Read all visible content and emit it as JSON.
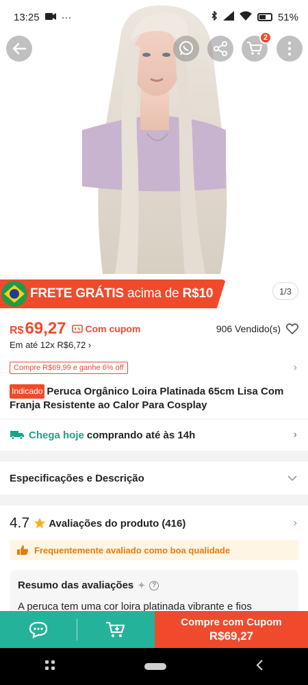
{
  "status": {
    "time": "13:25",
    "battery": "51%"
  },
  "hero": {
    "pager": "1/3",
    "cart_count": "2"
  },
  "banner": {
    "text_bold": "FRETE GRÁTIS",
    "text_light": "acima de",
    "text_amount": "R$10"
  },
  "price": {
    "currency": "R$",
    "value": "69,27",
    "coupon_label": "Com cupom",
    "sold": "906 Vendido(s)",
    "installments": "Em até 12x R$6,72 ›"
  },
  "promo": {
    "text": "Compre R$69,99 e ganhe 6% off"
  },
  "product": {
    "badge": "Indicado",
    "title": "Peruca Orgânico Loira Platinada 65cm Lisa Com Franja Resistente ao Calor Para Cosplay"
  },
  "delivery": {
    "green": "Chega hoje",
    "rest": "comprando até às 14h"
  },
  "specs": {
    "label": "Especificações e Descrição"
  },
  "reviews": {
    "rating": "4.7",
    "label": "Avaliações do produto",
    "count": "(416)",
    "quality_note": "Frequentemente avaliado como boa qualidade"
  },
  "summary": {
    "title": "Resumo das avaliações",
    "body": "A peruca tem uma cor loira platinada vibrante e fios"
  },
  "actions": {
    "buy_line1": "Compre com Cupom",
    "buy_line2": "R$69,27"
  },
  "colors": {
    "accent": "#f04a2c",
    "green": "#24b39a",
    "delivery_green": "#17a589",
    "quality_orange": "#e57b0f"
  }
}
